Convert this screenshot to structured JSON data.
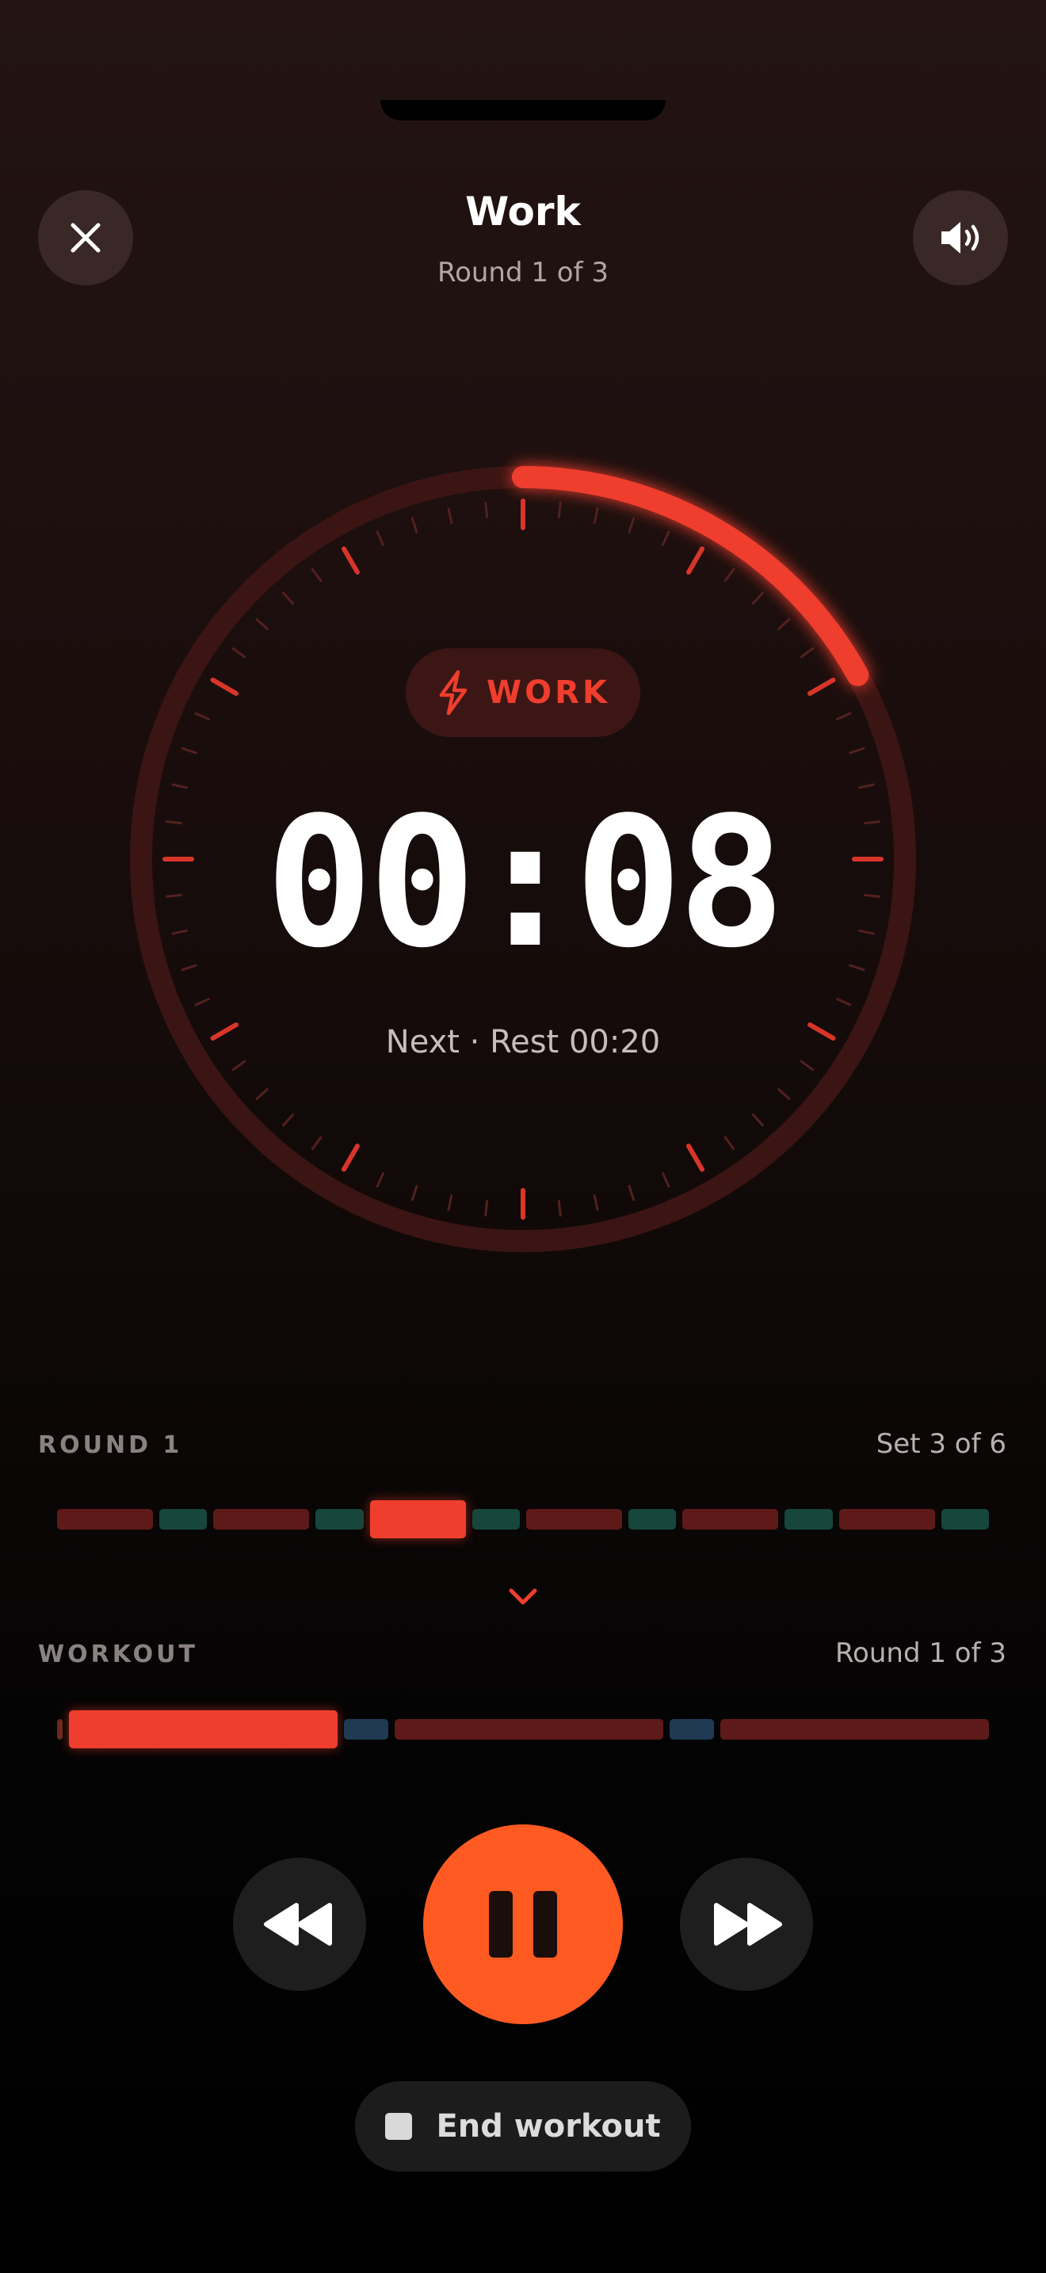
{
  "header": {
    "title": "Work",
    "subtitle": "Round 1 of 3",
    "close_icon": "close-icon",
    "sound_icon": "volume-icon"
  },
  "timer": {
    "phase_label": "WORK",
    "phase_icon": "lightning-icon",
    "time": "00:08",
    "next": "Next · Rest 00:20",
    "progress": 0.17,
    "accent_color": "#EF3E2D"
  },
  "round_section": {
    "title": "ROUND 1",
    "status": "Set 3 of 6",
    "segments": [
      {
        "type": "work",
        "state": "upcoming"
      },
      {
        "type": "rest",
        "state": "upcoming"
      },
      {
        "type": "work",
        "state": "upcoming"
      },
      {
        "type": "rest",
        "state": "upcoming"
      },
      {
        "type": "work",
        "state": "current"
      },
      {
        "type": "rest",
        "state": "upcoming"
      },
      {
        "type": "work",
        "state": "upcoming"
      },
      {
        "type": "rest",
        "state": "upcoming"
      },
      {
        "type": "work",
        "state": "upcoming"
      },
      {
        "type": "rest",
        "state": "upcoming"
      },
      {
        "type": "work",
        "state": "upcoming"
      },
      {
        "type": "rest",
        "state": "upcoming"
      }
    ],
    "expand_icon": "chevron-down-icon"
  },
  "workout_section": {
    "title": "WORKOUT",
    "status": "Round 1 of 3",
    "segments": [
      {
        "type": "warmup",
        "state": "done"
      },
      {
        "type": "round",
        "state": "current"
      },
      {
        "type": "break",
        "state": "upcoming"
      },
      {
        "type": "round",
        "state": "upcoming"
      },
      {
        "type": "break",
        "state": "upcoming"
      },
      {
        "type": "round",
        "state": "upcoming"
      }
    ]
  },
  "controls": {
    "rewind_icon": "rewind-icon",
    "pause_icon": "pause-icon",
    "forward_icon": "fast-forward-icon",
    "end_label": "End workout",
    "end_icon": "stop-icon"
  },
  "colors": {
    "work": "#5E1A18",
    "work_active": "#EF3E2D",
    "rest": "#16463C",
    "break": "#1F3A52",
    "play": "#FE5A22"
  }
}
